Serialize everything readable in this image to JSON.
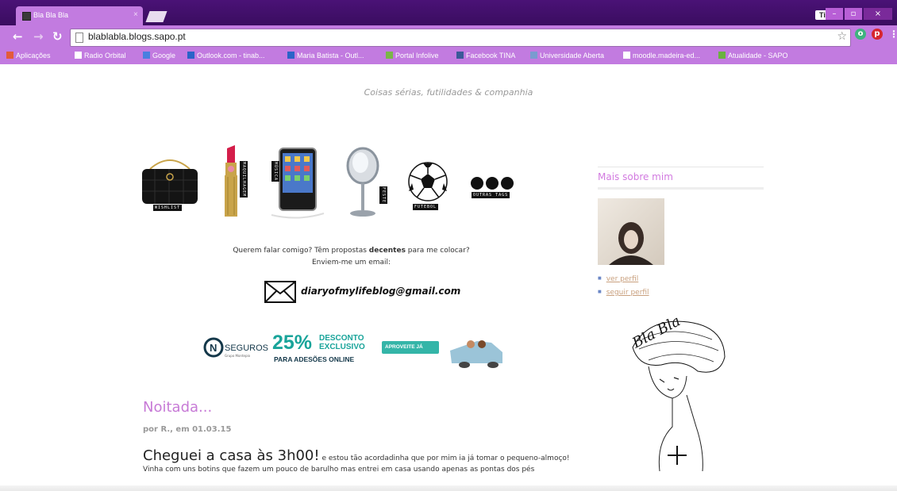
{
  "browser": {
    "tab_title": "Bla Bla Bla",
    "tab_close": "×",
    "url": "blablabla.blogs.sapo.pt",
    "user_label": "Tina",
    "window_buttons": [
      "–",
      "▫",
      "×"
    ],
    "accent_color": "#c27be0",
    "titlebar_color": "#3a0d60",
    "bookmarks": [
      {
        "label": "Aplicações",
        "icon": "apps-grid-icon",
        "color": "#e35b3b"
      },
      {
        "label": "Radio Orbital",
        "icon": "page-icon",
        "color": "#ffffff"
      },
      {
        "label": "Google",
        "icon": "google-icon",
        "color": "#4a7fe0"
      },
      {
        "label": "Outlook.com - tinab...",
        "icon": "outlook-icon",
        "color": "#2a63c8"
      },
      {
        "label": "Maria Batista - Outl...",
        "icon": "outlook-icon",
        "color": "#2a63c8"
      },
      {
        "label": "Portal Infolive",
        "icon": "infolive-icon",
        "color": "#7ab648"
      },
      {
        "label": "Facebook TINA",
        "icon": "facebook-icon",
        "color": "#3b5998"
      },
      {
        "label": "Universidade Aberta",
        "icon": "folder-icon",
        "color": "#7a9bd0"
      },
      {
        "label": "moodle.madeira-ed...",
        "icon": "page-icon",
        "color": "#ffffff"
      },
      {
        "label": "Atualidade - SAPO",
        "icon": "sapo-icon",
        "color": "#6ab23f"
      }
    ]
  },
  "blog": {
    "tagline": "Coisas sérias, futilidades & companhia",
    "categories": [
      {
        "label": "WISHLIST",
        "icon": "handbag-icon"
      },
      {
        "label": "MAQUILHAGEM",
        "icon": "lipstick-icon"
      },
      {
        "label": "MÚSICA",
        "icon": "ipod-icon"
      },
      {
        "label": "FESTE",
        "icon": "mirror-icon"
      },
      {
        "label": "FUTEBOL",
        "icon": "football-icon"
      },
      {
        "label": "OUTRAS TAGS",
        "icon": "dots-icon"
      }
    ],
    "contact_line_before": "Querem falar comigo? Têm propostas ",
    "contact_emphasis": "decentes",
    "contact_line_after": " para me colocar?",
    "contact_line2": "Enviem-me um email:",
    "email": "diaryofmylifeblog@gmail.com",
    "ad": {
      "brand": "SEGUROS",
      "brand_sub": "Grupo Montepio",
      "percent": "25%",
      "headline1": "DESCONTO",
      "headline2": "EXCLUSIVO",
      "subline": "PARA ADESÕES ONLINE",
      "cta": "APROVEITE JÁ"
    },
    "post": {
      "title": "Noitada...",
      "meta": "por R., em 01.03.15",
      "lead_big": "Cheguei a casa às 3h00!",
      "lead_rest": " e estou tão acordadinha que por mim ia já tomar o pequeno-almoço!",
      "line2": "Vinha com uns botins que fazem um pouco de barulho mas entrei em casa usando apenas as pontas dos pés"
    }
  },
  "sidebar": {
    "title": "Mais sobre mim",
    "links": [
      "ver perfil",
      "seguir perfil"
    ],
    "sketch_text": "Bla Bla"
  }
}
